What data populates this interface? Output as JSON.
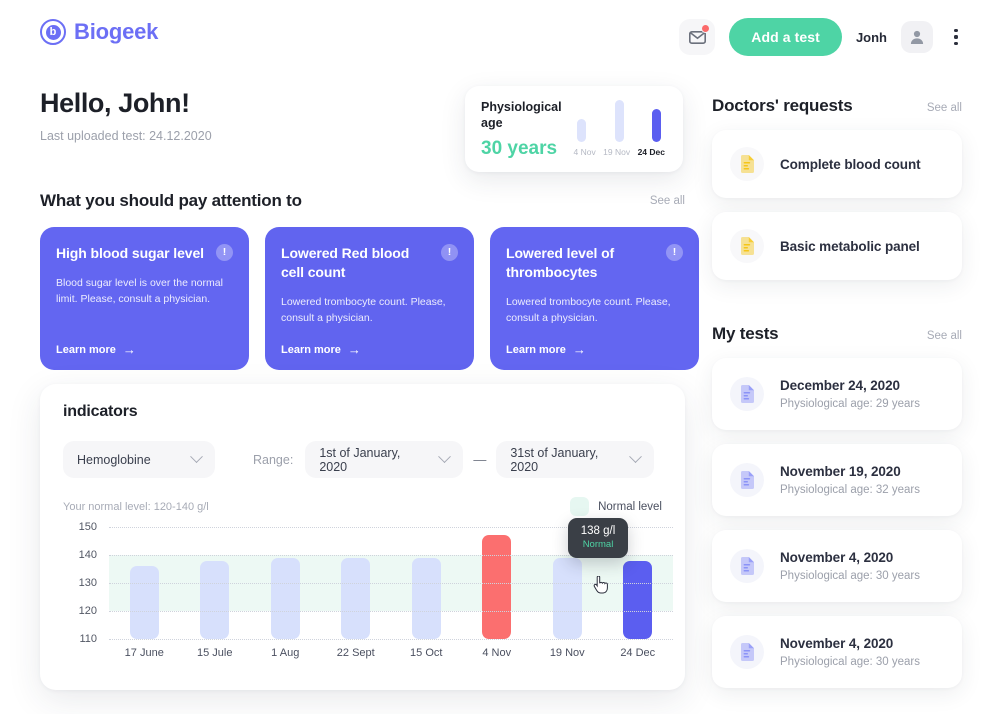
{
  "brand": {
    "name": "Biogeek",
    "mark_letter": "b",
    "accent": "#6c6ff5"
  },
  "header": {
    "mail_icon": "envelope-icon",
    "add_test_label": "Add a test",
    "user_name": "Jonh",
    "avatar_icon": "user-avatar-icon",
    "menu_icon": "kebab-menu-icon"
  },
  "greeting": {
    "title": "Hello, John!",
    "subtitle": "Last uploaded test: 24.12.2020"
  },
  "phys_age": {
    "label": "Physiological age",
    "value": "30 years",
    "value_color": "#4ed4a5",
    "bars": [
      {
        "label": "4 Nov",
        "height_pct": 55,
        "active": false
      },
      {
        "label": "19 Nov",
        "height_pct": 100,
        "active": false
      },
      {
        "label": "24 Dec",
        "height_pct": 78,
        "active": true
      }
    ]
  },
  "attention": {
    "title": "What you should pay attention to",
    "see_all": "See all",
    "cards": [
      {
        "title": "High blood sugar level",
        "info_icon": "info-icon",
        "desc": "Blood sugar level is over the normal limit. Please, consult a physician.",
        "link": "Learn more"
      },
      {
        "title": "Lowered Red blood cell count",
        "info_icon": "info-icon",
        "desc": "Lowered trombocyte count. Please, consult a physician.",
        "link": "Learn more"
      },
      {
        "title": "Lowered level of thrombocytes",
        "info_icon": "info-icon",
        "desc": "Lowered trombocyte count. Please, consult a physician.",
        "link": "Learn more"
      }
    ]
  },
  "indicators": {
    "title": "indicators",
    "analyte": "Hemoglobine",
    "range_label": "Range:",
    "date_from": "1st of January, 2020",
    "date_to": "31st of January, 2020",
    "dash": "—",
    "normal_note": "Your normal level: 120-140 g/l",
    "legend_label": "Normal level",
    "legend_color": "#e6f7f1",
    "tooltip": {
      "value": "138 g/l",
      "status": "Normal"
    }
  },
  "chart_data": {
    "type": "bar",
    "title": "indicators",
    "xlabel": "",
    "ylabel": "g/l",
    "ylim": [
      110,
      150
    ],
    "yticks": [
      150,
      140,
      130,
      120,
      110
    ],
    "grid": true,
    "normal_band": [
      120,
      140
    ],
    "categories": [
      "17 June",
      "15 Jule",
      "1 Aug",
      "22 Sept",
      "15 Oct",
      "4 Nov",
      "19 Nov",
      "24 Dec"
    ],
    "values": [
      136,
      138,
      139,
      139,
      139,
      147,
      139,
      138
    ],
    "bar_states": [
      "normal",
      "normal",
      "normal",
      "normal",
      "normal",
      "high",
      "normal",
      "active"
    ],
    "colors": {
      "normal": "#d7e0fc",
      "high": "#fb6f6f",
      "active": "#5b5ef0",
      "band": "#edf9f4"
    },
    "legend": [
      "Normal level"
    ],
    "legend_position": "top-right",
    "annotations": [
      {
        "category": "24 Dec",
        "value": "138 g/l",
        "status": "Normal"
      }
    ]
  },
  "doctors_requests": {
    "title": "Doctors' requests",
    "see_all": "See all",
    "items": [
      {
        "icon": "document-icon",
        "label": "Complete blood count"
      },
      {
        "icon": "document-icon",
        "label": "Basic metabolic panel"
      }
    ]
  },
  "my_tests": {
    "title": "My tests",
    "see_all": "See all",
    "items": [
      {
        "icon": "document-icon",
        "date": "December 24, 2020",
        "sub": "Physiological age: 29 years"
      },
      {
        "icon": "document-icon",
        "date": "November 19, 2020",
        "sub": "Physiological age:  32 years"
      },
      {
        "icon": "document-icon",
        "date": "November 4, 2020",
        "sub": "Physiological age:  30 years"
      },
      {
        "icon": "document-icon",
        "date": " November 4, 2020",
        "sub": "Physiological age:  30 years"
      }
    ]
  }
}
